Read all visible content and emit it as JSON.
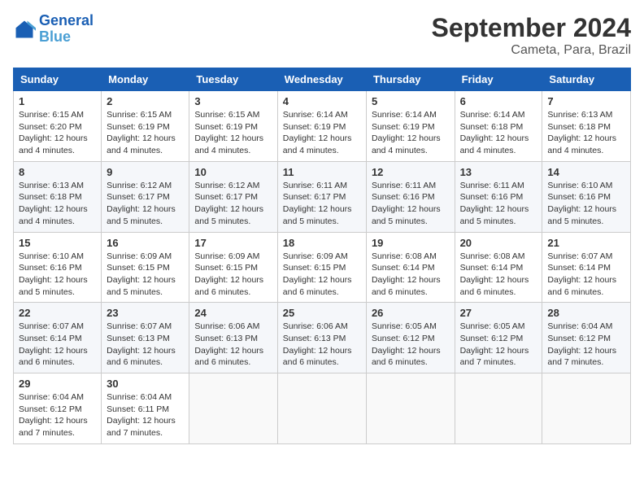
{
  "header": {
    "logo_line1": "General",
    "logo_line2": "Blue",
    "month_year": "September 2024",
    "location": "Cameta, Para, Brazil"
  },
  "days_of_week": [
    "Sunday",
    "Monday",
    "Tuesday",
    "Wednesday",
    "Thursday",
    "Friday",
    "Saturday"
  ],
  "weeks": [
    [
      {
        "day": "1",
        "text": "Sunrise: 6:15 AM\nSunset: 6:20 PM\nDaylight: 12 hours and 4 minutes."
      },
      {
        "day": "2",
        "text": "Sunrise: 6:15 AM\nSunset: 6:19 PM\nDaylight: 12 hours and 4 minutes."
      },
      {
        "day": "3",
        "text": "Sunrise: 6:15 AM\nSunset: 6:19 PM\nDaylight: 12 hours and 4 minutes."
      },
      {
        "day": "4",
        "text": "Sunrise: 6:14 AM\nSunset: 6:19 PM\nDaylight: 12 hours and 4 minutes."
      },
      {
        "day": "5",
        "text": "Sunrise: 6:14 AM\nSunset: 6:19 PM\nDaylight: 12 hours and 4 minutes."
      },
      {
        "day": "6",
        "text": "Sunrise: 6:14 AM\nSunset: 6:18 PM\nDaylight: 12 hours and 4 minutes."
      },
      {
        "day": "7",
        "text": "Sunrise: 6:13 AM\nSunset: 6:18 PM\nDaylight: 12 hours and 4 minutes."
      }
    ],
    [
      {
        "day": "8",
        "text": "Sunrise: 6:13 AM\nSunset: 6:18 PM\nDaylight: 12 hours and 4 minutes."
      },
      {
        "day": "9",
        "text": "Sunrise: 6:12 AM\nSunset: 6:17 PM\nDaylight: 12 hours and 5 minutes."
      },
      {
        "day": "10",
        "text": "Sunrise: 6:12 AM\nSunset: 6:17 PM\nDaylight: 12 hours and 5 minutes."
      },
      {
        "day": "11",
        "text": "Sunrise: 6:11 AM\nSunset: 6:17 PM\nDaylight: 12 hours and 5 minutes."
      },
      {
        "day": "12",
        "text": "Sunrise: 6:11 AM\nSunset: 6:16 PM\nDaylight: 12 hours and 5 minutes."
      },
      {
        "day": "13",
        "text": "Sunrise: 6:11 AM\nSunset: 6:16 PM\nDaylight: 12 hours and 5 minutes."
      },
      {
        "day": "14",
        "text": "Sunrise: 6:10 AM\nSunset: 6:16 PM\nDaylight: 12 hours and 5 minutes."
      }
    ],
    [
      {
        "day": "15",
        "text": "Sunrise: 6:10 AM\nSunset: 6:16 PM\nDaylight: 12 hours and 5 minutes."
      },
      {
        "day": "16",
        "text": "Sunrise: 6:09 AM\nSunset: 6:15 PM\nDaylight: 12 hours and 5 minutes."
      },
      {
        "day": "17",
        "text": "Sunrise: 6:09 AM\nSunset: 6:15 PM\nDaylight: 12 hours and 6 minutes."
      },
      {
        "day": "18",
        "text": "Sunrise: 6:09 AM\nSunset: 6:15 PM\nDaylight: 12 hours and 6 minutes."
      },
      {
        "day": "19",
        "text": "Sunrise: 6:08 AM\nSunset: 6:14 PM\nDaylight: 12 hours and 6 minutes."
      },
      {
        "day": "20",
        "text": "Sunrise: 6:08 AM\nSunset: 6:14 PM\nDaylight: 12 hours and 6 minutes."
      },
      {
        "day": "21",
        "text": "Sunrise: 6:07 AM\nSunset: 6:14 PM\nDaylight: 12 hours and 6 minutes."
      }
    ],
    [
      {
        "day": "22",
        "text": "Sunrise: 6:07 AM\nSunset: 6:14 PM\nDaylight: 12 hours and 6 minutes."
      },
      {
        "day": "23",
        "text": "Sunrise: 6:07 AM\nSunset: 6:13 PM\nDaylight: 12 hours and 6 minutes."
      },
      {
        "day": "24",
        "text": "Sunrise: 6:06 AM\nSunset: 6:13 PM\nDaylight: 12 hours and 6 minutes."
      },
      {
        "day": "25",
        "text": "Sunrise: 6:06 AM\nSunset: 6:13 PM\nDaylight: 12 hours and 6 minutes."
      },
      {
        "day": "26",
        "text": "Sunrise: 6:05 AM\nSunset: 6:12 PM\nDaylight: 12 hours and 6 minutes."
      },
      {
        "day": "27",
        "text": "Sunrise: 6:05 AM\nSunset: 6:12 PM\nDaylight: 12 hours and 7 minutes."
      },
      {
        "day": "28",
        "text": "Sunrise: 6:04 AM\nSunset: 6:12 PM\nDaylight: 12 hours and 7 minutes."
      }
    ],
    [
      {
        "day": "29",
        "text": "Sunrise: 6:04 AM\nSunset: 6:12 PM\nDaylight: 12 hours and 7 minutes."
      },
      {
        "day": "30",
        "text": "Sunrise: 6:04 AM\nSunset: 6:11 PM\nDaylight: 12 hours and 7 minutes."
      },
      {
        "day": "",
        "text": ""
      },
      {
        "day": "",
        "text": ""
      },
      {
        "day": "",
        "text": ""
      },
      {
        "day": "",
        "text": ""
      },
      {
        "day": "",
        "text": ""
      }
    ]
  ]
}
